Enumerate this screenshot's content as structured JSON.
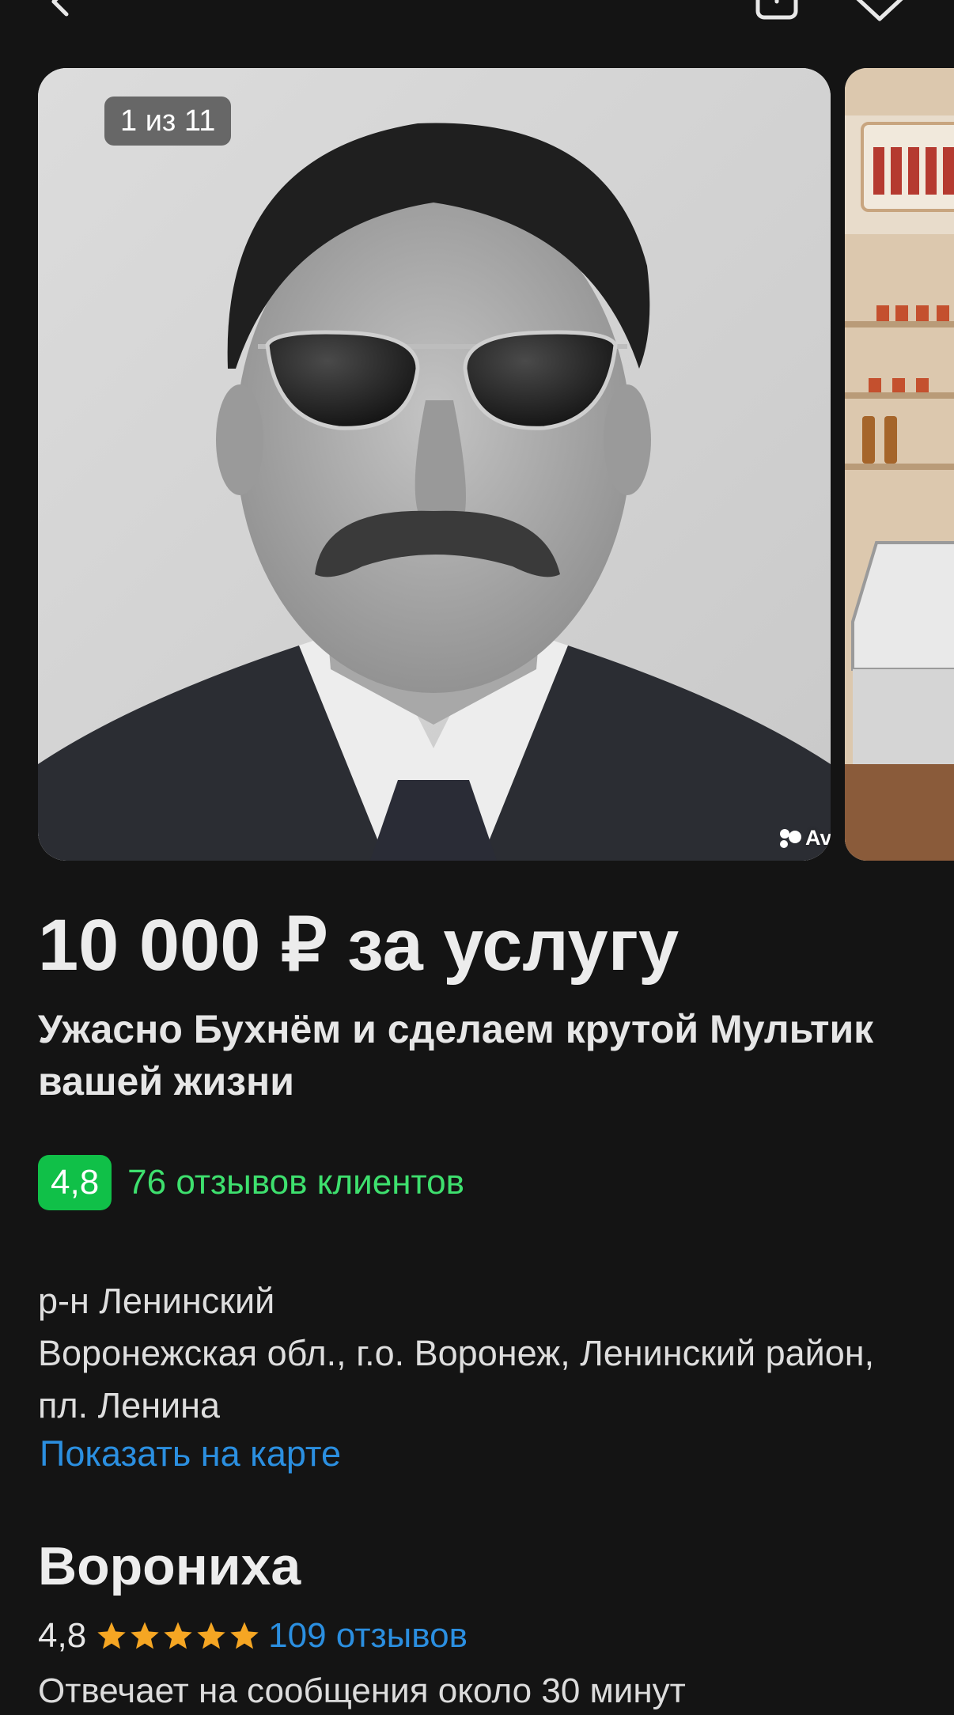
{
  "header": {
    "back_icon": "chevron-left-icon",
    "share_icon": "share-icon",
    "favorite_icon": "heart-icon"
  },
  "gallery": {
    "counter": "1 из 11",
    "watermark": "Avito"
  },
  "listing": {
    "price": "10 000 ₽ за услугу",
    "title": "Ужасно Бухнём и сделаем крутой Мультик вашей жизни"
  },
  "rating": {
    "score": "4,8",
    "reviews_label": "76 отзывов клиентов",
    "badge_color": "#10c048"
  },
  "address": {
    "district": "р-н Ленинский",
    "full": "Воронежская обл., г.о. Воронеж, Ленинский район, пл. Ленина",
    "map_link": "Показать на карте"
  },
  "seller": {
    "name": "Ворониха",
    "score": "4,8",
    "stars": 5,
    "reviews": "109 отзывов",
    "response_time": "Отвечает на сообщения около 30 минут"
  },
  "colors": {
    "background": "#141414",
    "link": "#2b8fe0",
    "accent_green": "#3ee06e",
    "star": "#f5a623"
  }
}
